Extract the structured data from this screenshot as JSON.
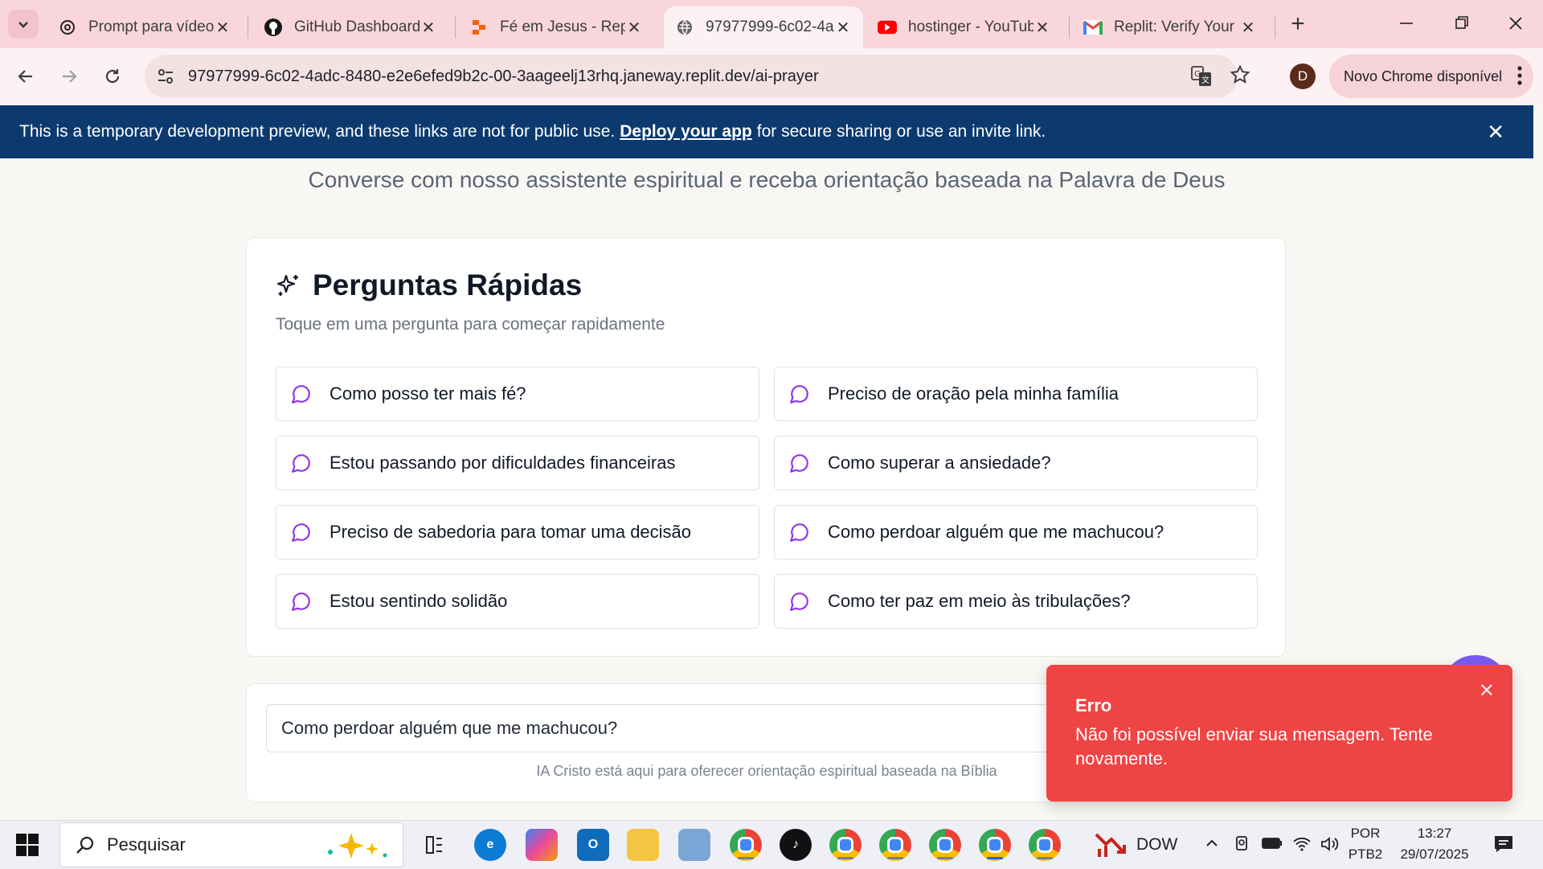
{
  "browser": {
    "tabs": [
      {
        "title": "Prompt para vídeo",
        "icon": "openai-icon"
      },
      {
        "title": "GitHub Dashboard",
        "icon": "github-icon"
      },
      {
        "title": "Fé em Jesus - Repl",
        "icon": "replit-icon"
      },
      {
        "title": "97977999-6c02-4a",
        "icon": "globe-icon",
        "active": true
      },
      {
        "title": "hostinger - YouTub",
        "icon": "youtube-icon"
      },
      {
        "title": "Replit: Verify Your",
        "icon": "gmail-icon"
      }
    ],
    "url": "97977999-6c02-4adc-8480-e2e6efed9b2c-00-3aageelj13rhq.janeway.replit.dev/ai-prayer",
    "profile_initial": "D",
    "update_label": "Novo Chrome disponível"
  },
  "banner": {
    "text_before": "This is a temporary development preview, and these links are not for public use.",
    "link": "Deploy your app",
    "text_after": "for secure sharing or use an invite link."
  },
  "page": {
    "subtitle": "Converse com nosso assistente espiritual e receba orientação baseada na Palavra de Deus",
    "quick": {
      "title": "Perguntas Rápidas",
      "description": "Toque em uma pergunta para começar rapidamente",
      "questions": [
        "Como posso ter mais fé?",
        "Preciso de oração pela minha família",
        "Estou passando por dificuldades financeiras",
        "Como superar a ansiedade?",
        "Preciso de sabedoria para tomar uma decisão",
        "Como perdoar alguém que me machucou?",
        "Estou sentindo solidão",
        "Como ter paz em meio às tribulações?"
      ]
    },
    "input_value": "Como perdoar alguém que me machucou?",
    "footnote": "IA Cristo está aqui para oferecer orientação espiritual baseada na Bíblia"
  },
  "toast": {
    "title": "Erro",
    "message": "Não foi possível enviar sua mensagem. Tente novamente."
  },
  "taskbar": {
    "search_label": "Pesquisar",
    "app_label": "DOW",
    "language": "POR",
    "keyboard": "PTB2",
    "time": "13:27",
    "date": "29/07/2025"
  },
  "colors": {
    "accent_purple": "#9333ea",
    "banner_bg": "#0c3a6e",
    "toast_bg": "#ef4444",
    "tabstrip_bg": "#f9d6dc"
  }
}
